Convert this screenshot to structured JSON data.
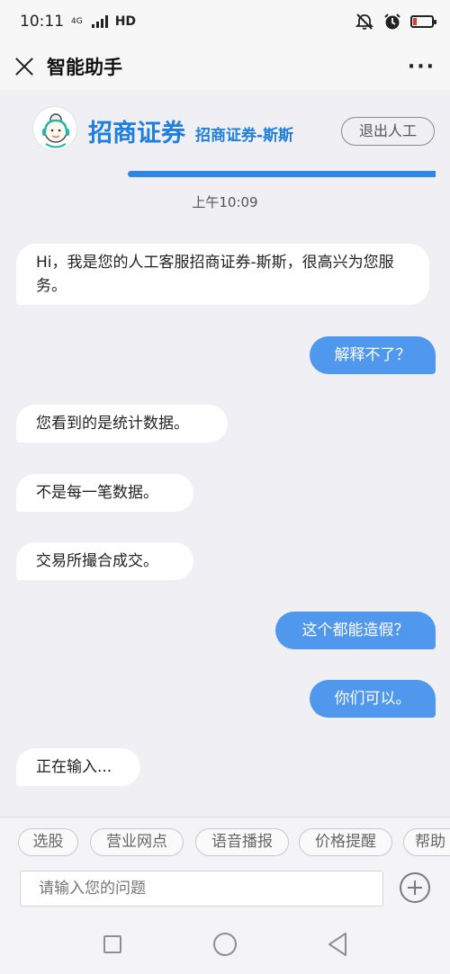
{
  "status_bar": {
    "time": "10:11",
    "network": "4G",
    "hd": "HD",
    "icons": [
      "signal-icon",
      "mute-icon",
      "alarm-icon",
      "battery-icon"
    ],
    "battery_color": "#e53935"
  },
  "title_bar": {
    "title": "智能助手",
    "more": "···"
  },
  "agent": {
    "brand": "招商证券",
    "name": "招商证券-斯斯",
    "exit_label": "退出人工"
  },
  "chat": {
    "timestamp": "上午10:09",
    "messages": [
      {
        "side": "left",
        "text": "Hi，我是您的人工客服招商证券-斯斯，很高兴为您服务。"
      },
      {
        "side": "right",
        "text": "解释不了？"
      },
      {
        "side": "left",
        "text": "您看到的是统计数据。"
      },
      {
        "side": "left",
        "text": "不是每一笔数据。"
      },
      {
        "side": "left",
        "text": "交易所撮合成交。"
      },
      {
        "side": "right",
        "text": "这个都能造假？"
      },
      {
        "side": "right",
        "text": "你们可以。"
      },
      {
        "side": "left",
        "text": "正在输入..."
      }
    ]
  },
  "quick_replies": [
    "选股",
    "营业网点",
    "语音播报",
    "价格提醒",
    "帮助"
  ],
  "input": {
    "placeholder": "请输入您的问题"
  },
  "colors": {
    "accent": "#1f7fe0",
    "user_bubble": "#4f98ee",
    "background": "#efeff4"
  }
}
